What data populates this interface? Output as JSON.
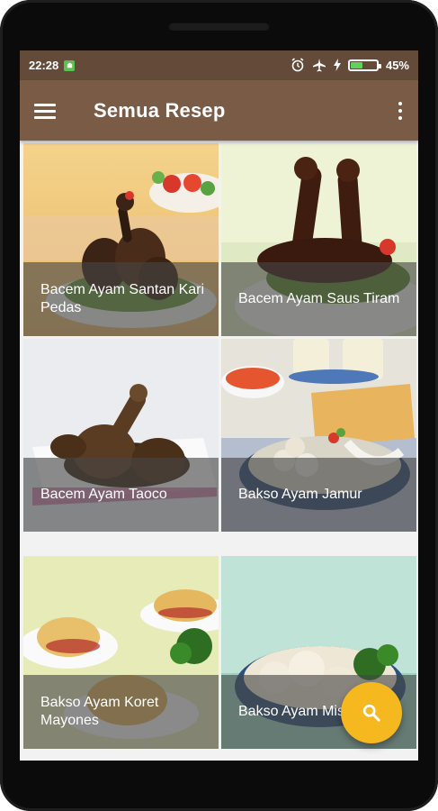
{
  "status_bar": {
    "time": "22:28",
    "notification_icon": "android-notification-icon",
    "alarm_icon": "alarm-clock-icon",
    "airplane_icon": "airplane-mode-icon",
    "charging_icon": "charging-bolt-icon",
    "battery_level": 0.45,
    "battery_text": "45%"
  },
  "app_bar": {
    "title": "Semua Resep",
    "menu_icon": "hamburger-menu-icon",
    "overflow_icon": "more-vert-icon",
    "color": "#7a5b46"
  },
  "recipes": [
    {
      "title": "Bacem Ayam Santan Kari Pedas"
    },
    {
      "title": "Bacem Ayam Saus Tiram"
    },
    {
      "title": "Bacem Ayam Taoco"
    },
    {
      "title": "Bakso Ayam Jamur"
    },
    {
      "title": "Bakso Ayam Koret Mayones"
    },
    {
      "title": "Bakso Ayam Mis"
    }
  ],
  "fab": {
    "icon": "search-icon",
    "color": "#f6b81f"
  }
}
